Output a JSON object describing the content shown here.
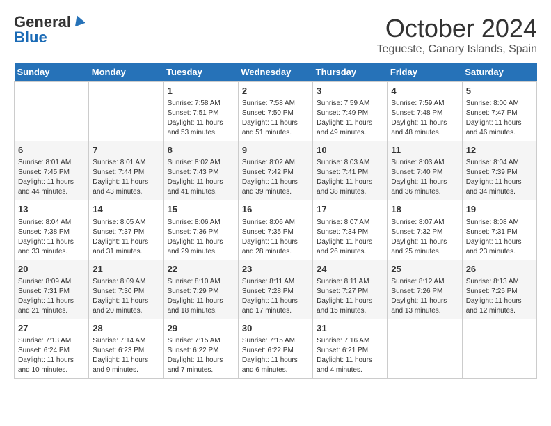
{
  "header": {
    "logo_general": "General",
    "logo_blue": "Blue",
    "month": "October 2024",
    "location": "Tegueste, Canary Islands, Spain"
  },
  "days_of_week": [
    "Sunday",
    "Monday",
    "Tuesday",
    "Wednesday",
    "Thursday",
    "Friday",
    "Saturday"
  ],
  "weeks": [
    [
      {
        "day": "",
        "info": ""
      },
      {
        "day": "",
        "info": ""
      },
      {
        "day": "1",
        "info": "Sunrise: 7:58 AM\nSunset: 7:51 PM\nDaylight: 11 hours and 53 minutes."
      },
      {
        "day": "2",
        "info": "Sunrise: 7:58 AM\nSunset: 7:50 PM\nDaylight: 11 hours and 51 minutes."
      },
      {
        "day": "3",
        "info": "Sunrise: 7:59 AM\nSunset: 7:49 PM\nDaylight: 11 hours and 49 minutes."
      },
      {
        "day": "4",
        "info": "Sunrise: 7:59 AM\nSunset: 7:48 PM\nDaylight: 11 hours and 48 minutes."
      },
      {
        "day": "5",
        "info": "Sunrise: 8:00 AM\nSunset: 7:47 PM\nDaylight: 11 hours and 46 minutes."
      }
    ],
    [
      {
        "day": "6",
        "info": "Sunrise: 8:01 AM\nSunset: 7:45 PM\nDaylight: 11 hours and 44 minutes."
      },
      {
        "day": "7",
        "info": "Sunrise: 8:01 AM\nSunset: 7:44 PM\nDaylight: 11 hours and 43 minutes."
      },
      {
        "day": "8",
        "info": "Sunrise: 8:02 AM\nSunset: 7:43 PM\nDaylight: 11 hours and 41 minutes."
      },
      {
        "day": "9",
        "info": "Sunrise: 8:02 AM\nSunset: 7:42 PM\nDaylight: 11 hours and 39 minutes."
      },
      {
        "day": "10",
        "info": "Sunrise: 8:03 AM\nSunset: 7:41 PM\nDaylight: 11 hours and 38 minutes."
      },
      {
        "day": "11",
        "info": "Sunrise: 8:03 AM\nSunset: 7:40 PM\nDaylight: 11 hours and 36 minutes."
      },
      {
        "day": "12",
        "info": "Sunrise: 8:04 AM\nSunset: 7:39 PM\nDaylight: 11 hours and 34 minutes."
      }
    ],
    [
      {
        "day": "13",
        "info": "Sunrise: 8:04 AM\nSunset: 7:38 PM\nDaylight: 11 hours and 33 minutes."
      },
      {
        "day": "14",
        "info": "Sunrise: 8:05 AM\nSunset: 7:37 PM\nDaylight: 11 hours and 31 minutes."
      },
      {
        "day": "15",
        "info": "Sunrise: 8:06 AM\nSunset: 7:36 PM\nDaylight: 11 hours and 29 minutes."
      },
      {
        "day": "16",
        "info": "Sunrise: 8:06 AM\nSunset: 7:35 PM\nDaylight: 11 hours and 28 minutes."
      },
      {
        "day": "17",
        "info": "Sunrise: 8:07 AM\nSunset: 7:34 PM\nDaylight: 11 hours and 26 minutes."
      },
      {
        "day": "18",
        "info": "Sunrise: 8:07 AM\nSunset: 7:32 PM\nDaylight: 11 hours and 25 minutes."
      },
      {
        "day": "19",
        "info": "Sunrise: 8:08 AM\nSunset: 7:31 PM\nDaylight: 11 hours and 23 minutes."
      }
    ],
    [
      {
        "day": "20",
        "info": "Sunrise: 8:09 AM\nSunset: 7:31 PM\nDaylight: 11 hours and 21 minutes."
      },
      {
        "day": "21",
        "info": "Sunrise: 8:09 AM\nSunset: 7:30 PM\nDaylight: 11 hours and 20 minutes."
      },
      {
        "day": "22",
        "info": "Sunrise: 8:10 AM\nSunset: 7:29 PM\nDaylight: 11 hours and 18 minutes."
      },
      {
        "day": "23",
        "info": "Sunrise: 8:11 AM\nSunset: 7:28 PM\nDaylight: 11 hours and 17 minutes."
      },
      {
        "day": "24",
        "info": "Sunrise: 8:11 AM\nSunset: 7:27 PM\nDaylight: 11 hours and 15 minutes."
      },
      {
        "day": "25",
        "info": "Sunrise: 8:12 AM\nSunset: 7:26 PM\nDaylight: 11 hours and 13 minutes."
      },
      {
        "day": "26",
        "info": "Sunrise: 8:13 AM\nSunset: 7:25 PM\nDaylight: 11 hours and 12 minutes."
      }
    ],
    [
      {
        "day": "27",
        "info": "Sunrise: 7:13 AM\nSunset: 6:24 PM\nDaylight: 11 hours and 10 minutes."
      },
      {
        "day": "28",
        "info": "Sunrise: 7:14 AM\nSunset: 6:23 PM\nDaylight: 11 hours and 9 minutes."
      },
      {
        "day": "29",
        "info": "Sunrise: 7:15 AM\nSunset: 6:22 PM\nDaylight: 11 hours and 7 minutes."
      },
      {
        "day": "30",
        "info": "Sunrise: 7:15 AM\nSunset: 6:22 PM\nDaylight: 11 hours and 6 minutes."
      },
      {
        "day": "31",
        "info": "Sunrise: 7:16 AM\nSunset: 6:21 PM\nDaylight: 11 hours and 4 minutes."
      },
      {
        "day": "",
        "info": ""
      },
      {
        "day": "",
        "info": ""
      }
    ]
  ]
}
